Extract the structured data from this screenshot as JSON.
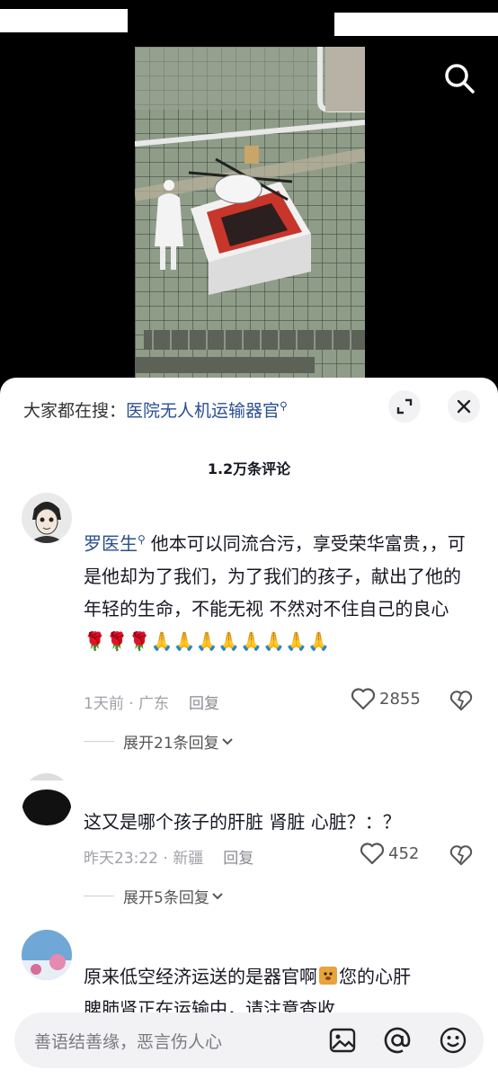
{
  "hot_search": {
    "prefix": "大家都在搜：",
    "keyword": "医院无人机运输器官"
  },
  "comment_count": "1.2万条评论",
  "comments": [
    {
      "author": "罗医生",
      "text": "他本可以同流合污，享受荣华富贵，，可是他却为了我们，为了我们的孩子，献出了他的年轻的生命，不能无视 不然对不住自己的良心",
      "emoji_flowers": "🌹🌹🌹",
      "emoji_pray": "🙏🙏🙏🙏🙏🙏🙏🙏",
      "time": "1天前 · 广东",
      "reply_label": "回复",
      "likes": "2855",
      "expand_label": "展开21条回复"
    },
    {
      "text": "这又是哪个孩子的肝脏 肾脏 心脏？：？",
      "time": "昨天23:22 · 新疆",
      "reply_label": "回复",
      "likes": "452",
      "expand_label": "展开5条回复"
    },
    {
      "text_line1": "原来低空经济运送的是器官啊",
      "text_line1_tail": "您的心肝",
      "text_line2": "脾肺肾正在运输中，请注意查收"
    }
  ],
  "input": {
    "placeholder": "善语结善缘，恶言伤人心"
  },
  "colors": {
    "link_blue": "#2a4f8f",
    "meta_gray": "#a0a0a8",
    "sheet_bg": "#ffffff"
  }
}
